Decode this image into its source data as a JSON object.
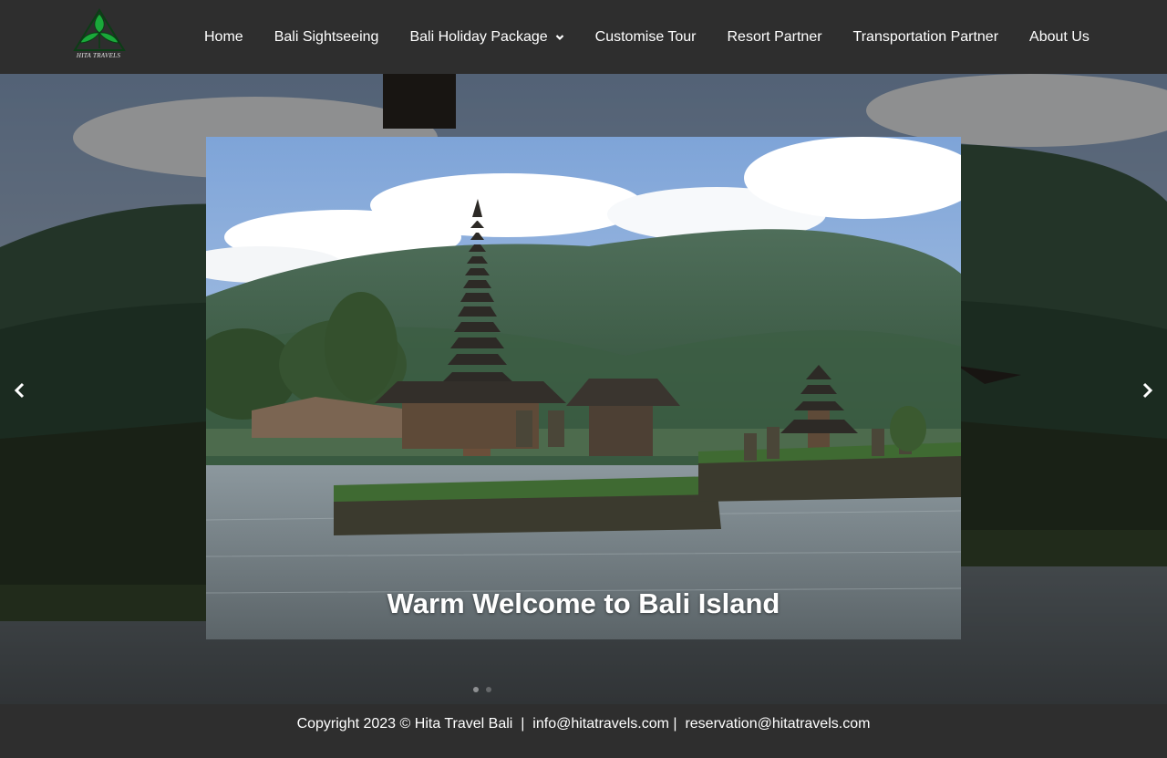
{
  "brand": {
    "logo_text": "HITA TRAVELS",
    "logo_colors": {
      "leaf": "#1aa83a",
      "outline": "#0b3d15"
    }
  },
  "nav": {
    "items": [
      {
        "label": "Home"
      },
      {
        "label": "Bali Sightseeing"
      },
      {
        "label": "Bali Holiday Package",
        "has_dropdown": true
      },
      {
        "label": "Customise Tour"
      },
      {
        "label": "Resort Partner"
      },
      {
        "label": "Transportation Partner"
      },
      {
        "label": "About Us"
      }
    ]
  },
  "hero": {
    "caption": "Warm Welcome to Bali Island",
    "slide_count": 2,
    "active_slide": 1,
    "prev_icon": "chevron-left-icon",
    "next_icon": "chevron-right-icon"
  },
  "footer": {
    "copyright": "Copyright 2023 © Hita Travel Bali",
    "separator": "|",
    "email_info": "info@hitatravels.com",
    "email_reservation": "reservation@hitatravels.com"
  },
  "colors": {
    "header_bg": "#2e2e2e",
    "footer_bg": "#2e2e2e",
    "text": "#ffffff"
  }
}
